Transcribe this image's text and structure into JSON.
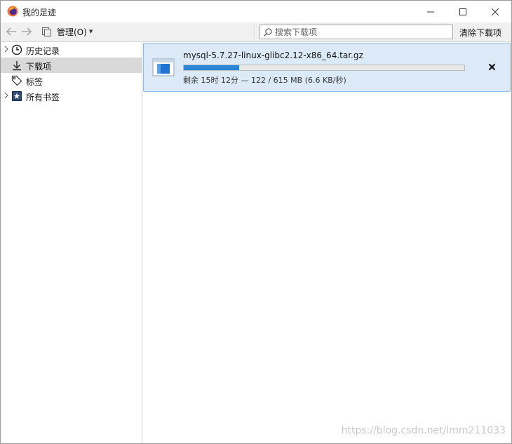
{
  "window": {
    "title": "我的足迹"
  },
  "toolbar": {
    "organize_label": "管理(O)",
    "search_placeholder": "搜索下载项",
    "clear_label": "清除下载项"
  },
  "sidebar": {
    "items": [
      {
        "label": "历史记录",
        "icon": "clock-icon",
        "expandable": true,
        "selected": false
      },
      {
        "label": "下载项",
        "icon": "download-arrow-icon",
        "expandable": false,
        "selected": true
      },
      {
        "label": "标签",
        "icon": "tag-icon",
        "expandable": false,
        "selected": false
      },
      {
        "label": "所有书签",
        "icon": "star-bookmark-icon",
        "expandable": true,
        "selected": false
      }
    ]
  },
  "downloads": [
    {
      "file_name": "mysql-5.7.27-linux-glibc2.12-x86_64.tar.gz",
      "status": "剩余 15时 12分 — 122 / 615 MB (6.6 KB/秒)",
      "progress_percent": 19.8
    }
  ],
  "watermark": "https://blog.csdn.net/lmm211033",
  "colors": {
    "selection_bg": "#d9d9d9",
    "download_item_bg": "#dceaf8",
    "download_item_border": "#93b9e4",
    "progress_fill": "#2a87d8"
  }
}
